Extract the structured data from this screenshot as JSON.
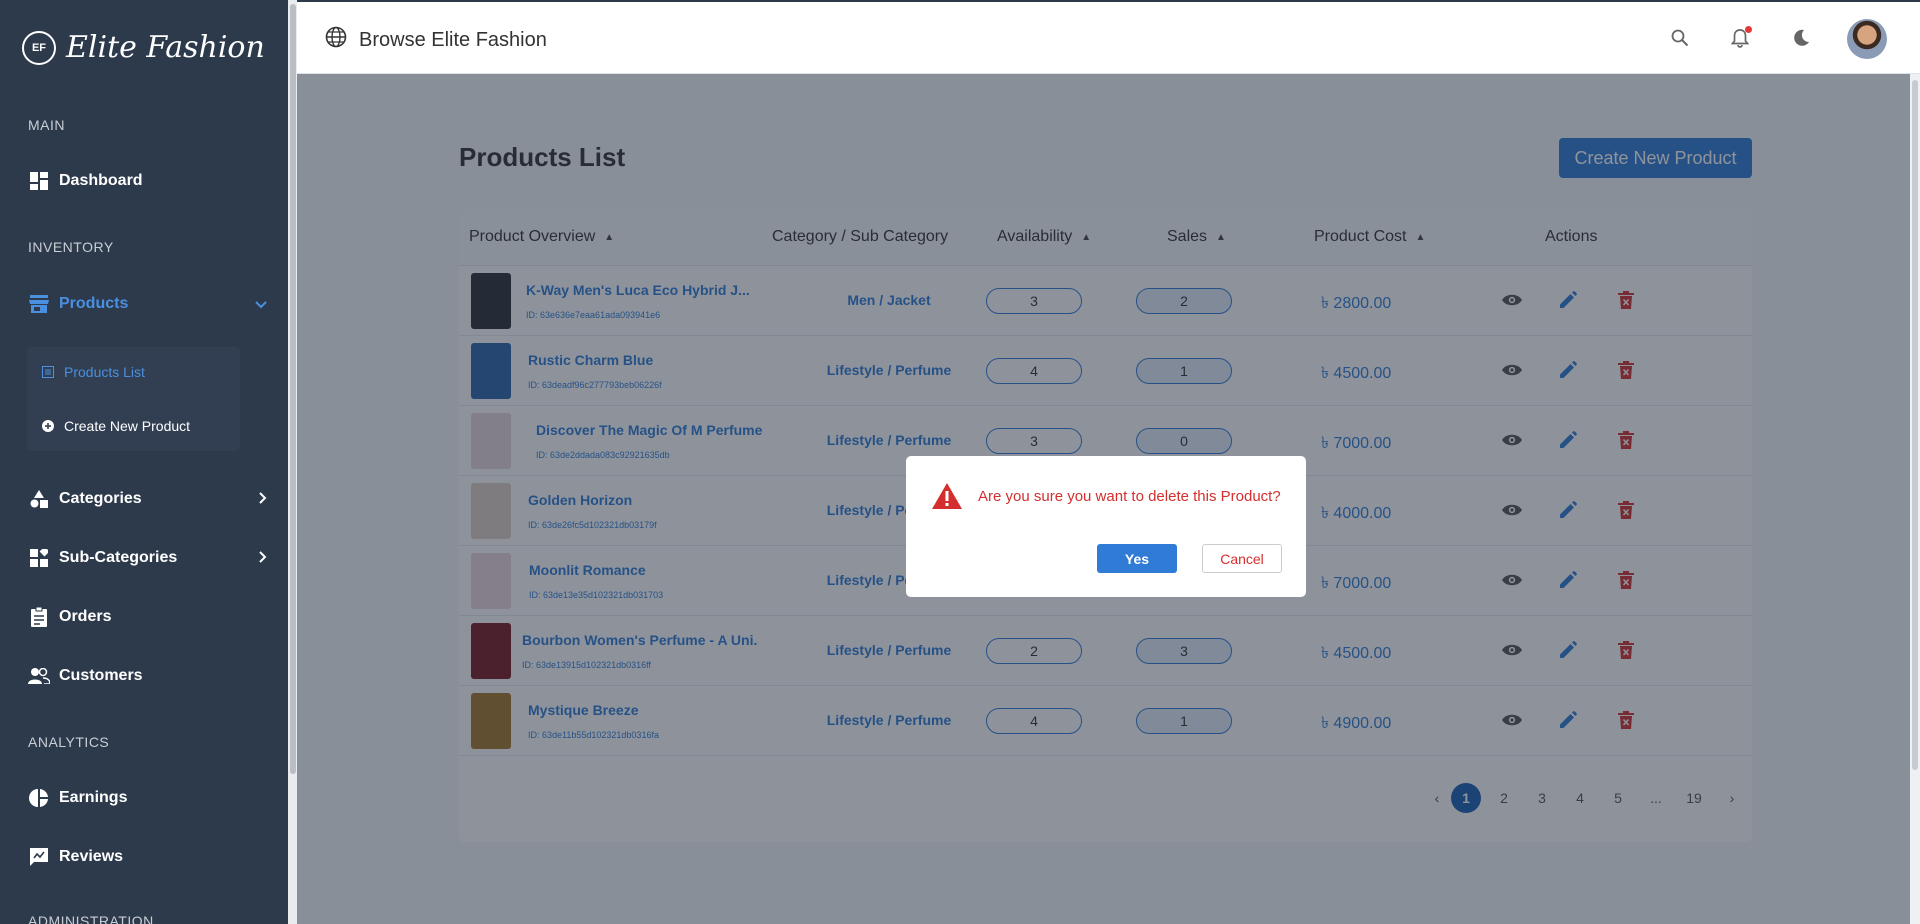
{
  "brand": {
    "name": "Elite Fashion",
    "logo_mark": "EF"
  },
  "sidebar": {
    "sections": {
      "main": "MAIN",
      "inventory": "INVENTORY",
      "analytics": "ANALYTICS",
      "administration": "ADMINISTRATION"
    },
    "items": {
      "dashboard": "Dashboard",
      "products": "Products",
      "products_list": "Products List",
      "create_new_product": "Create New Product",
      "categories": "Categories",
      "sub_categories": "Sub-Categories",
      "orders": "Orders",
      "customers": "Customers",
      "earnings": "Earnings",
      "reviews": "Reviews"
    }
  },
  "topbar": {
    "title": "Browse Elite Fashion"
  },
  "page": {
    "title": "Products List",
    "create_button": "Create New Product"
  },
  "table": {
    "headers": {
      "overview": "Product Overview",
      "category": "Category / Sub Category",
      "availability": "Availability",
      "sales": "Sales",
      "cost": "Product Cost",
      "actions": "Actions"
    },
    "rows": [
      {
        "name": "K-Way Men's Luca Eco Hybrid J...",
        "id": "ID: 63e636e7eaa61ada093941e6",
        "category": "Men / Jacket",
        "availability": "3",
        "sales": "2",
        "cost": "৳ 2800.00"
      },
      {
        "name": "Rustic Charm Blue",
        "id": "ID: 63deadf96c277793beb06226f",
        "category": "Lifestyle / Perfume",
        "availability": "4",
        "sales": "1",
        "cost": "৳ 4500.00"
      },
      {
        "name": "Discover The Magic Of M Perfume",
        "id": "ID: 63de2ddada083c92921635db",
        "category": "Lifestyle / Perfume",
        "availability": "3",
        "sales": "0",
        "cost": "৳ 7000.00"
      },
      {
        "name": "Golden Horizon",
        "id": "ID: 63de26fc5d102321db03179f",
        "category": "Lifestyle / Perfume",
        "availability": "",
        "sales": "",
        "cost": "৳ 4000.00"
      },
      {
        "name": "Moonlit Romance",
        "id": "ID: 63de13e35d102321db031703",
        "category": "Lifestyle / Perfume",
        "availability": "",
        "sales": "",
        "cost": "৳ 7000.00"
      },
      {
        "name": "Bourbon Women's Perfume - A Uni...",
        "id": "ID: 63de13915d102321db0316ff",
        "category": "Lifestyle / Perfume",
        "availability": "2",
        "sales": "3",
        "cost": "৳ 4500.00"
      },
      {
        "name": "Mystique Breeze",
        "id": "ID: 63de11b55d102321db0316fa",
        "category": "Lifestyle / Perfume",
        "availability": "4",
        "sales": "1",
        "cost": "৳ 4900.00"
      }
    ]
  },
  "pagination": {
    "prev": "‹",
    "pages": [
      "1",
      "2",
      "3",
      "4",
      "5",
      "...",
      "19"
    ],
    "next": "›",
    "current": "1"
  },
  "dialog": {
    "message": "Are you sure you want to delete this Product?",
    "yes": "Yes",
    "cancel": "Cancel"
  },
  "colors": {
    "sidebar_bg": "#2d3a4b",
    "accent": "#2f7bd5",
    "danger": "#d32f2f"
  },
  "icons": [
    "dashboard-icon",
    "store-icon",
    "shapes-icon",
    "widgets-icon",
    "clipboard-icon",
    "people-icon",
    "pie-chart-icon",
    "rate-review-icon",
    "globe-icon",
    "search-icon",
    "bell-icon",
    "moon-icon",
    "eye-icon",
    "pencil-icon",
    "trash-icon",
    "warning-icon"
  ]
}
